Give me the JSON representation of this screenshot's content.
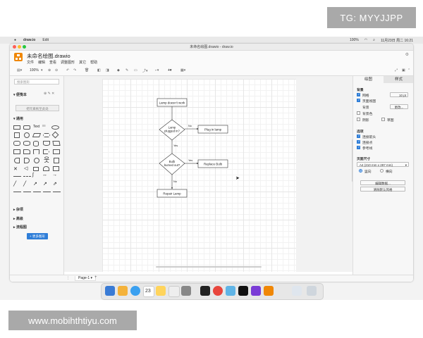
{
  "watermarks": {
    "top": "TG: MYYJJPP",
    "bottom": "www.mobihthtiyu.com"
  },
  "menubar": {
    "app": "draw.io",
    "items": [
      "Edit"
    ],
    "battery": "100%",
    "clock": "11月23日 周二 16:21"
  },
  "window": {
    "title": "未命名绘图.drawio - draw.io",
    "filename": "未命名绘图.drawio",
    "menu": [
      "文件",
      "编辑",
      "查看",
      "调整图形",
      "其它",
      "帮助"
    ],
    "zoom": "100%"
  },
  "left_panel": {
    "search_placeholder": "搜索图形",
    "scratchpad": "便笺本",
    "scratch_button": "把元素拖至此处",
    "general": "通用",
    "misc": "杂项",
    "advanced": "高级",
    "flowchart": "流程图",
    "more_shapes": "+ 更多图形"
  },
  "diagram": {
    "nodes": {
      "lamp_doesnt_work": "Lamp doesn't work",
      "lamp_plugged_in_1": "Lamp",
      "lamp_plugged_in_2": "plugged in?",
      "plug_in_lamp": "Plug in lamp",
      "bulb_burned_out_1": "Bulb",
      "bulb_burned_out_2": "burned out?",
      "replace_bulb": "Replace Bulb",
      "repair_lamp": "Repair Lamp"
    },
    "edges": {
      "no_1": "No",
      "yes_1": "Yes",
      "yes_2": "Yes",
      "no_2": "No"
    }
  },
  "right_panel": {
    "tab_diagram": "绘图",
    "tab_style": "样式",
    "background": "背景",
    "grid": "网格",
    "grid_size": "10 pt",
    "page_view": "页面视图",
    "background_color": "背景",
    "change": "更改...",
    "background_image": "背景色",
    "shadow": "阴影",
    "sketch": "草图",
    "options": "选项",
    "connection_arrows": "连接箭头",
    "connection_points": "连接点",
    "guides": "参考线",
    "paper_size": "页面尺寸",
    "paper_value": "A4 (210 mm x 297 mm)",
    "portrait": "竖向",
    "landscape": "横向",
    "edit_data": "编辑数据...",
    "clear_default_style": "清除默认风格"
  },
  "statusbar": {
    "page": "Page-1"
  }
}
